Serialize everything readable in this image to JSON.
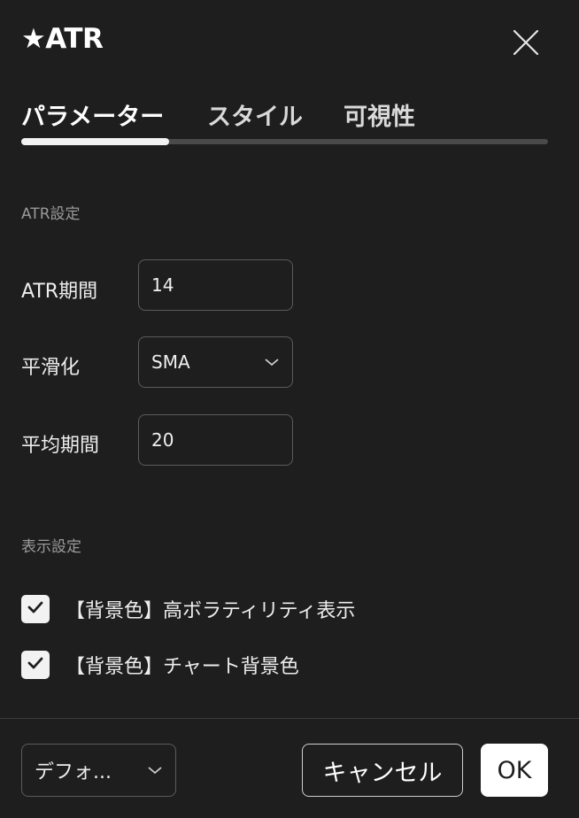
{
  "dialog": {
    "title": "★ATR",
    "close_icon": "close-icon"
  },
  "tabs": [
    {
      "label": "パラメーター",
      "active": true
    },
    {
      "label": "スタイル",
      "active": false
    },
    {
      "label": "可視性",
      "active": false
    }
  ],
  "atr_section": {
    "heading": "ATR設定",
    "fields": [
      {
        "label": "ATR期間",
        "value": "14",
        "type": "number"
      },
      {
        "label": "平滑化",
        "value": "SMA",
        "type": "select"
      },
      {
        "label": "平均期間",
        "value": "20",
        "type": "number"
      }
    ]
  },
  "display_section": {
    "heading": "表示設定",
    "options": [
      {
        "label": "【背景色】高ボラティリティ表示",
        "checked": true
      },
      {
        "label": "【背景色】チャート背景色",
        "checked": true
      }
    ]
  },
  "footer": {
    "defaults_label": "デフォ...",
    "cancel_label": "キャンセル",
    "ok_label": "OK"
  },
  "colors": {
    "background": "#1e1e1e",
    "text": "#e6e6e6",
    "muted": "#9a9a9a",
    "accent": "#ffffff"
  }
}
